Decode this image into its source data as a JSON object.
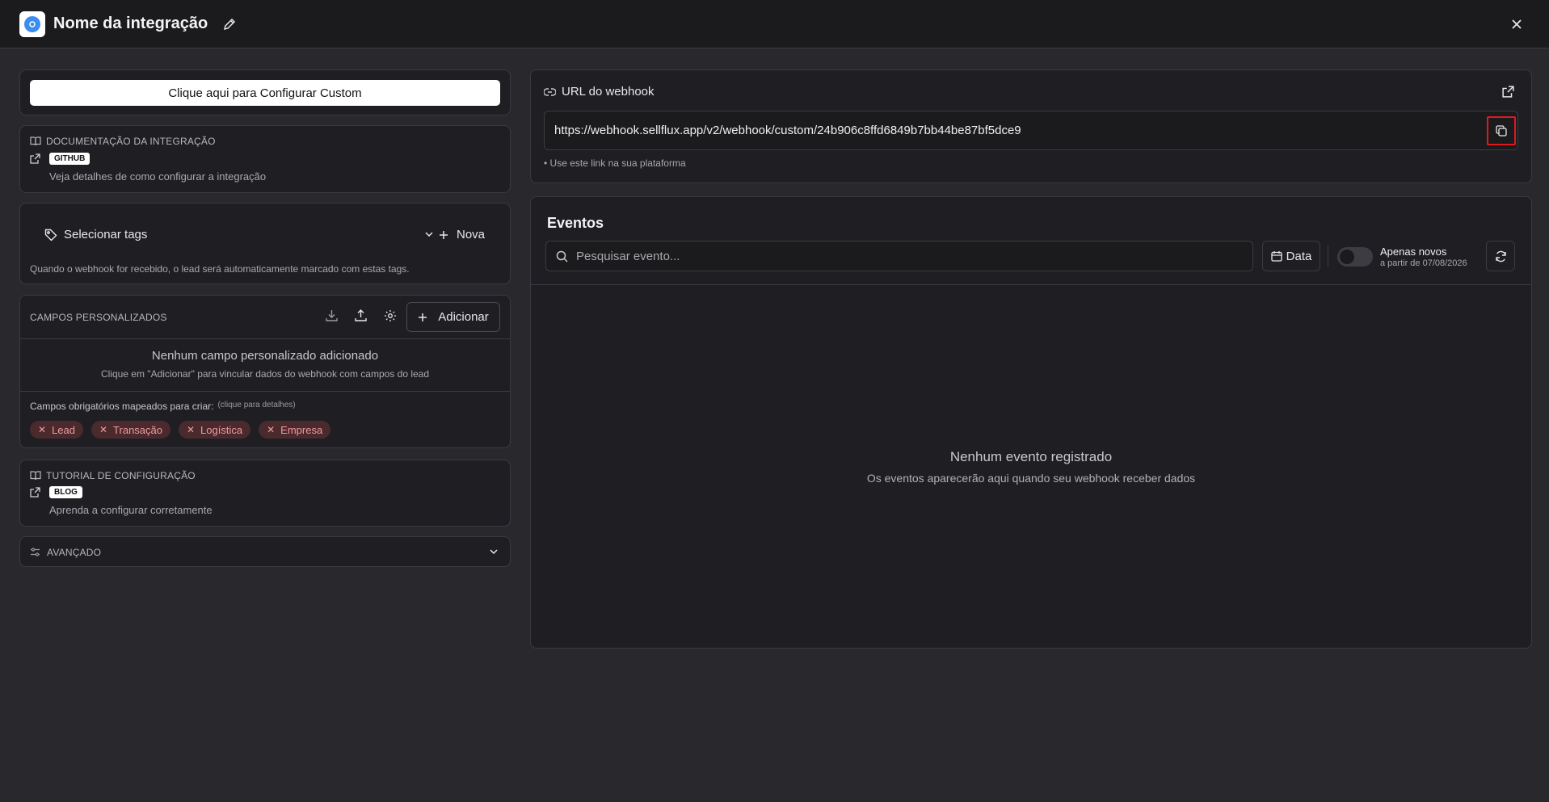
{
  "header": {
    "title": "Nome da integração",
    "icons": {
      "logo": "logo-icon",
      "edit": "pencil-icon",
      "close": "close-icon"
    }
  },
  "left": {
    "configure_button": "Clique aqui para Configurar Custom",
    "docs": {
      "heading": "DOCUMENTAÇÃO DA INTEGRAÇÃO",
      "badge": "GITHUB",
      "description": "Veja detalhes de como configurar a integração"
    },
    "tags": {
      "select_label": "Selecionar tags",
      "new_label": "Nova",
      "hint": "Quando o webhook for recebido, o lead será automaticamente marcado com estas tags."
    },
    "custom_fields": {
      "heading": "CAMPOS PERSONALIZADOS",
      "add_label": "Adicionar",
      "empty_title": "Nenhum campo personalizado adicionado",
      "empty_hint": "Clique em \"Adicionar\" para vincular dados do webhook com campos do lead",
      "required_label": "Campos obrigatórios mapeados para criar:",
      "required_hint": "(clique para detalhes)",
      "chips": [
        "Lead",
        "Transação",
        "Logística",
        "Empresa"
      ]
    },
    "tutorial": {
      "heading": "TUTORIAL DE CONFIGURAÇÃO",
      "badge": "BLOG",
      "description": "Aprenda a configurar corretamente"
    },
    "advanced": {
      "label": "AVANÇADO"
    }
  },
  "webhook": {
    "label": "URL do webhook",
    "url": "https://webhook.sellflux.app/v2/webhook/custom/24b906c8ffd6849b7bb44be87bf5dce9",
    "hint": "• Use este link na sua plataforma"
  },
  "events": {
    "title": "Eventos",
    "search_placeholder": "Pesquisar evento...",
    "date_label": "Data",
    "only_new_label": "Apenas novos",
    "only_new_since": "a partir de 07/08/2026",
    "only_new_enabled": false,
    "empty_title": "Nenhum evento registrado",
    "empty_hint": "Os eventos aparecerão aqui quando seu webhook receber dados"
  },
  "colors": {
    "background": "#29282d",
    "card": "#1f1f23",
    "border": "#3a3a40",
    "chip_bg": "#4a2a2d",
    "chip_text": "#f09a9f",
    "highlight": "#e0191f"
  }
}
